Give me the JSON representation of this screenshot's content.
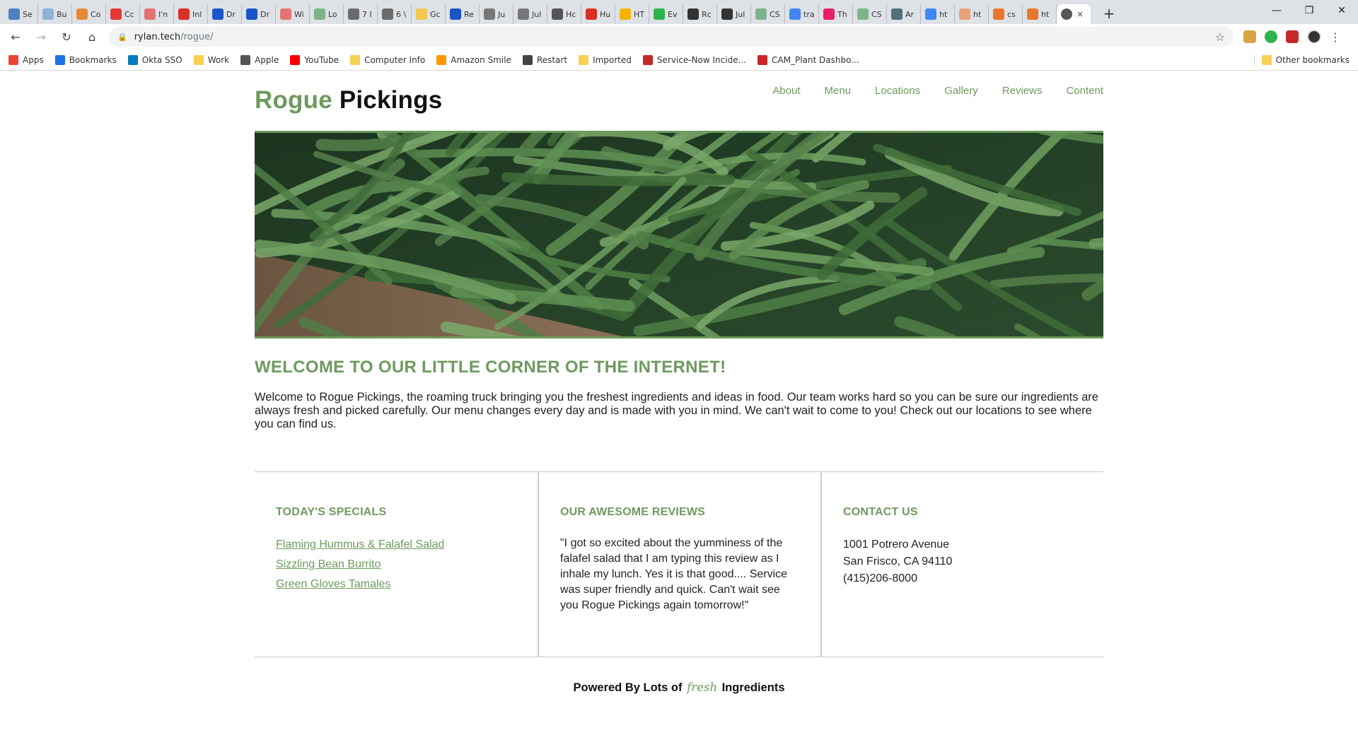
{
  "browser": {
    "tabs": [
      {
        "label": "Se",
        "color": "#4a7fc1"
      },
      {
        "label": "Bu",
        "color": "#8fb3d9"
      },
      {
        "label": "Co",
        "color": "#e8893a"
      },
      {
        "label": "Cc",
        "color": "#e53935"
      },
      {
        "label": "I'n",
        "color": "#e57373"
      },
      {
        "label": "Inl",
        "color": "#d93025"
      },
      {
        "label": "Dr",
        "color": "#1a55c8"
      },
      {
        "label": "Dr",
        "color": "#1a55c8"
      },
      {
        "label": "Wi",
        "color": "#e57373"
      },
      {
        "label": "Lo",
        "color": "#7cb38a"
      },
      {
        "label": "7 I",
        "color": "#6b6b6b"
      },
      {
        "label": "6 \\",
        "color": "#6b6b6b"
      },
      {
        "label": "Gc",
        "color": "#f2c94c"
      },
      {
        "label": "Re",
        "color": "#1a55c8"
      },
      {
        "label": "Ju",
        "color": "#777777"
      },
      {
        "label": "Jul",
        "color": "#777777"
      },
      {
        "label": "Hc",
        "color": "#555555"
      },
      {
        "label": "Hu",
        "color": "#d93025"
      },
      {
        "label": "HT",
        "color": "#f4b400"
      },
      {
        "label": "Ev",
        "color": "#2db34a"
      },
      {
        "label": "Rc",
        "color": "#333333"
      },
      {
        "label": "Jul",
        "color": "#333333"
      },
      {
        "label": "CS",
        "color": "#7cb38a"
      },
      {
        "label": "tra",
        "color": "#4285f4"
      },
      {
        "label": "Th",
        "color": "#e91e63"
      },
      {
        "label": "CS",
        "color": "#7cb38a"
      },
      {
        "label": "Ar",
        "color": "#546e7a"
      },
      {
        "label": "ht",
        "color": "#4285f4"
      },
      {
        "label": "ht",
        "color": "#e8a27c"
      },
      {
        "label": "cs",
        "color": "#e8772e"
      },
      {
        "label": "ht",
        "color": "#e8772e"
      }
    ],
    "active_tab_close": "×",
    "new_tab": "+",
    "window_controls": {
      "minimize": "—",
      "restore": "❐",
      "close": "✕"
    },
    "url": {
      "host": "rylan.tech",
      "path": "/rogue/"
    },
    "bookmarks": [
      {
        "label": "Apps",
        "icon": "apps-grid-icon",
        "color": "#ea4335"
      },
      {
        "label": "Bookmarks",
        "icon": "star-icon",
        "color": "#1a73e8"
      },
      {
        "label": "Okta SSO",
        "icon": "okta-icon",
        "color": "#007dc1"
      },
      {
        "label": "Work",
        "icon": "folder-icon",
        "color": "#f7d154"
      },
      {
        "label": "Apple",
        "icon": "apple-icon",
        "color": "#555555"
      },
      {
        "label": "YouTube",
        "icon": "youtube-icon",
        "color": "#ff0000"
      },
      {
        "label": "Computer Info",
        "icon": "folder-icon",
        "color": "#f7d154"
      },
      {
        "label": "Amazon Smile",
        "icon": "amazon-icon",
        "color": "#ff9900"
      },
      {
        "label": "Restart",
        "icon": "globe-icon",
        "color": "#444444"
      },
      {
        "label": "Imported",
        "icon": "folder-icon",
        "color": "#f7d154"
      },
      {
        "label": "Service-Now Incide...",
        "icon": "servicenow-icon",
        "color": "#c62828"
      },
      {
        "label": "CAM_Plant Dashbo...",
        "icon": "servicenow-icon",
        "color": "#c62828"
      }
    ],
    "other_bookmarks": "Other bookmarks"
  },
  "site": {
    "brand_part1": "Rogue",
    "brand_part2": "Pickings",
    "nav": [
      "About",
      "Menu",
      "Locations",
      "Gallery",
      "Reviews",
      "Content"
    ],
    "welcome_heading": "WELCOME TO OUR LITTLE CORNER OF THE INTERNET!",
    "welcome_text": "Welcome to Rogue Pickings, the roaming truck bringing you the freshest ingredients and ideas in food. Our team works hard so you can be sure our ingredients are always fresh and picked carefully. Our menu changes every day and is made with you in mind. We can't wait to come to you! Check out our locations to see where you can find us.",
    "specials_heading": "TODAY'S SPECIALS",
    "specials": [
      "Flaming Hummus & Falafel Salad",
      "Sizzling Bean Burrito",
      "Green Gloves Tamales"
    ],
    "reviews_heading": "OUR AWESOME REVIEWS",
    "review_text": "\"I got so excited about the yumminess of the falafel salad that I am typing this review as I inhale my lunch. Yes it is that good.... Service was super friendly and quick. Can't wait see you Rogue Pickings again tomorrow!\"",
    "contact_heading": "CONTACT US",
    "contact_lines": [
      "1001 Potrero Avenue",
      "San Frisco, CA 94110",
      "(415)206-8000"
    ],
    "footer_before": "Powered By Lots of",
    "footer_fresh": "fresh",
    "footer_after": "Ingredients"
  },
  "colors": {
    "accent_green": "#6e9a5e",
    "text_dark": "#222222"
  }
}
